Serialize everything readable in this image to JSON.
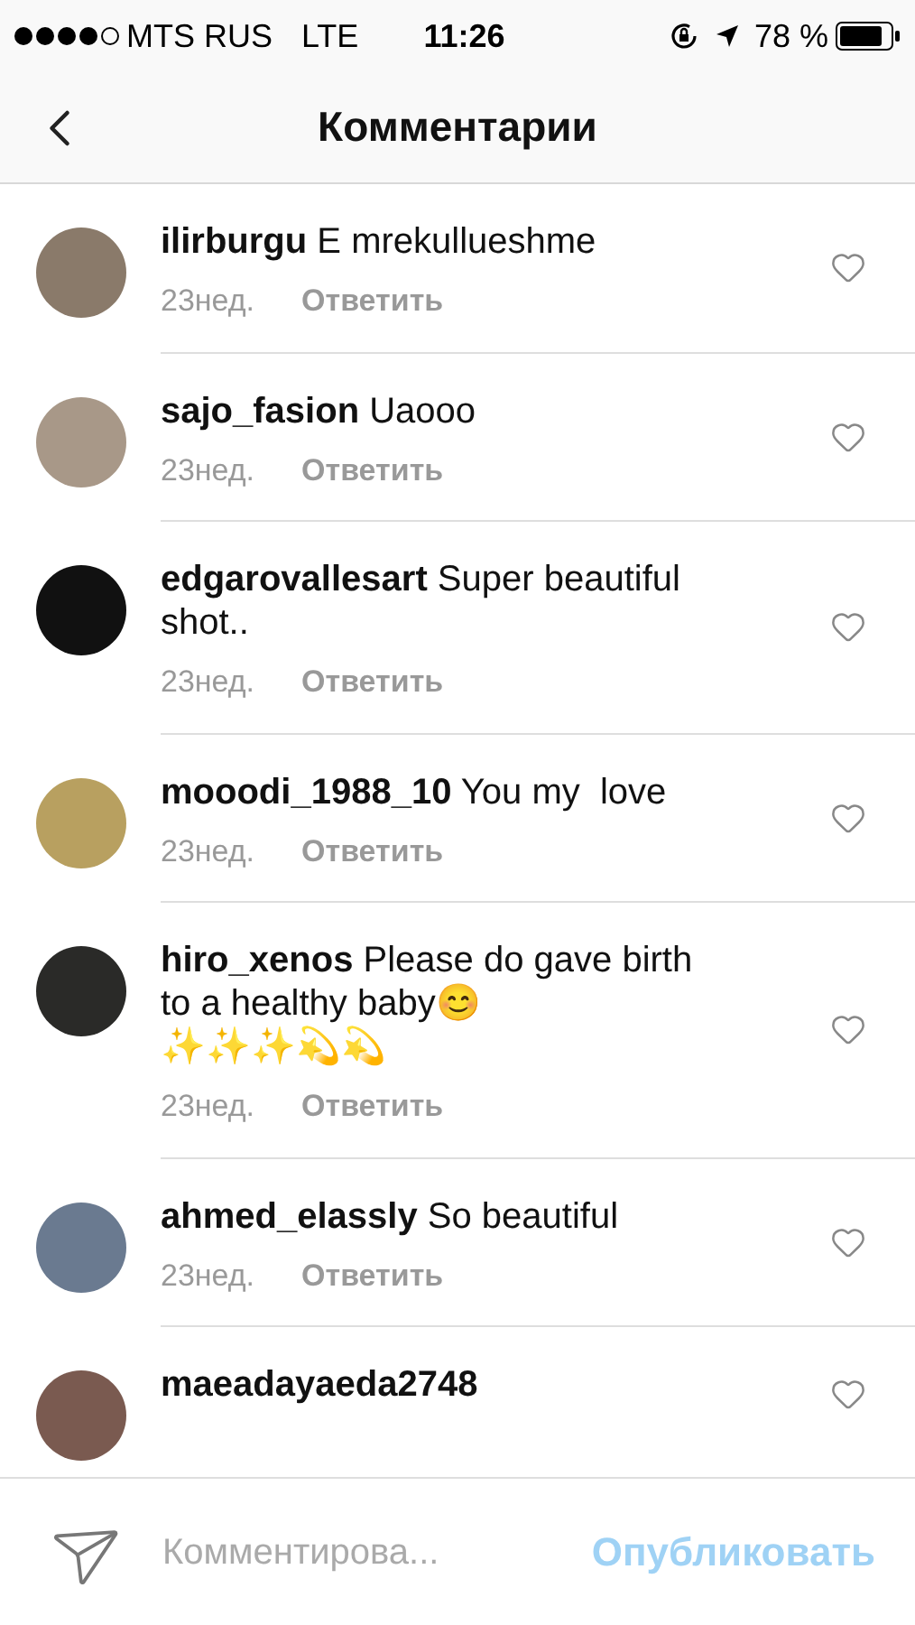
{
  "status_bar": {
    "carrier": "MTS RUS",
    "network": "LTE",
    "time": "11:26",
    "battery": "78 %"
  },
  "nav": {
    "title": "Комментарии"
  },
  "comments": [
    {
      "username": "ilirburgu",
      "text": "E mrekullueshme",
      "age": "23нед.",
      "reply": "Ответить"
    },
    {
      "username": "sajo_fasion",
      "text": "Uaooo",
      "age": "23нед.",
      "reply": "Ответить"
    },
    {
      "username": "edgarovallesart",
      "text": "Super beautiful shot..",
      "age": "23нед.",
      "reply": "Ответить"
    },
    {
      "username": "mooodi_1988_10",
      "text": "You my  love",
      "age": "23нед.",
      "reply": "Ответить"
    },
    {
      "username": "hiro_xenos",
      "text": "Please do gave birth to a healthy baby😊\n✨✨✨💫💫",
      "age": "23нед.",
      "reply": "Ответить"
    },
    {
      "username": "ahmed_elassly",
      "text": "So beautiful",
      "age": "23нед.",
      "reply": "Ответить"
    },
    {
      "username": "maeadayaeda2748"
    }
  ],
  "composer": {
    "placeholder": "Комментирова...",
    "post_button": "Опубликовать"
  }
}
